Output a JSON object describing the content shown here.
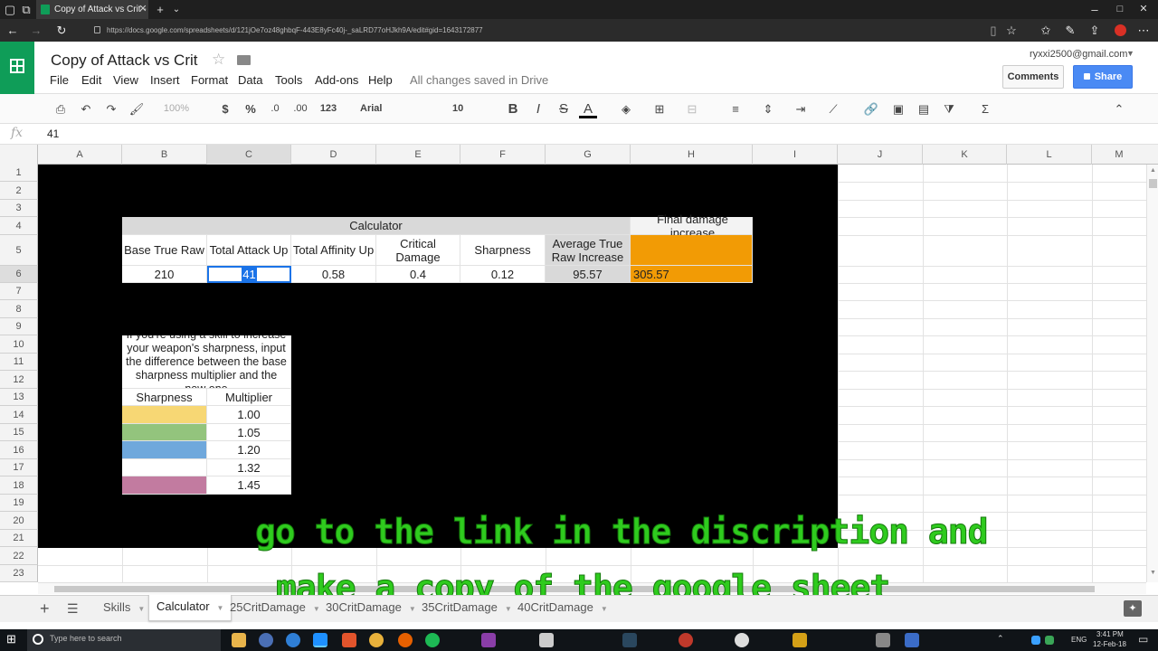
{
  "browser": {
    "tab_title": "Copy of Attack vs Crit -",
    "url": "https://docs.google.com/spreadsheets/d/121jOe7oz48ghbqF-443E8yFc40j-_saLRD77oHJkh9A/edit#gid=1643172877",
    "window_controls": [
      "–",
      "□",
      "✕"
    ]
  },
  "sheets": {
    "doc_title": "Copy of Attack vs Crit",
    "menu": [
      "File",
      "Edit",
      "View",
      "Insert",
      "Format",
      "Data",
      "Tools",
      "Add-ons",
      "Help"
    ],
    "save_status": "All changes saved in Drive",
    "account": "ryxxi2500@gmail.com",
    "comments_label": "Comments",
    "share_label": "Share"
  },
  "toolbar": {
    "zoom": "100%",
    "currency": "$",
    "percent": "%",
    "dec_decrease": ".0",
    "dec_increase": ".00",
    "more_formats": "123",
    "font": "Arial",
    "font_size": "10",
    "bold": "B",
    "italic": "I",
    "strike": "S",
    "text_color": "A"
  },
  "formula_bar": {
    "fx": "fx",
    "value": "41"
  },
  "columns": [
    "A",
    "B",
    "C",
    "D",
    "E",
    "F",
    "G",
    "H",
    "I",
    "J",
    "K",
    "L",
    "M"
  ],
  "rows": [
    "1",
    "2",
    "3",
    "4",
    "5",
    "6",
    "7",
    "8",
    "9",
    "10",
    "11",
    "12",
    "13",
    "14",
    "15",
    "16",
    "17",
    "18",
    "19",
    "20",
    "21",
    "22",
    "23"
  ],
  "calculator": {
    "title": "Calculator",
    "final_header": "Final damage increase",
    "headers": [
      "Base True Raw",
      "Total Attack Up",
      "Total Affinity Up",
      "Critical Damage",
      "Sharpness",
      "Average True Raw Increase"
    ],
    "values": [
      "210",
      "41",
      "0.58",
      "0.4",
      "0.12",
      "95.57"
    ],
    "final_value": "305.57"
  },
  "sharpness_table": {
    "note": "If you're using a skill to increase your weapon's sharpness, input the difference between the base sharpness multiplier and the new one",
    "headers": [
      "Sharpness",
      "Multiplier"
    ],
    "rows": [
      {
        "color": "#f7d774",
        "multiplier": "1.00"
      },
      {
        "color": "#93c47d",
        "multiplier": "1.05"
      },
      {
        "color": "#6fa8dc",
        "multiplier": "1.20"
      },
      {
        "color": "#ffffff",
        "multiplier": "1.32"
      },
      {
        "color": "#c27ba0",
        "multiplier": "1.45"
      }
    ]
  },
  "sheet_tabs": [
    "Skills",
    "Calculator",
    "25CritDamage",
    "30CritDamage",
    "35CritDamage",
    "40CritDamage"
  ],
  "active_sheet": "Calculator",
  "overlay": {
    "line1": "go to the link in the discription and",
    "line2": "make a copy of the google sheet"
  },
  "taskbar": {
    "search_placeholder": "Type here to search",
    "lang": "ENG",
    "time": "3:41 PM",
    "date": "12-Feb-18"
  },
  "colors": {
    "accent": "#1a73e8",
    "orange": "#f29b05",
    "sheets_green": "#0f9d58",
    "selection": "#1a73e8"
  }
}
